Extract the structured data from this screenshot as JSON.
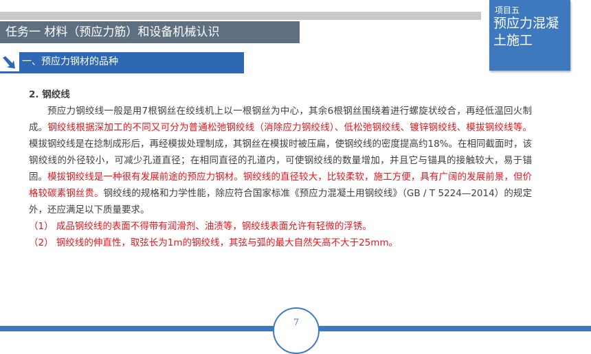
{
  "header": {
    "task_title": "任务一   材料（预应力筋）和设备机械认识",
    "project_label": "项目五",
    "project_name": "预应力混凝土施工"
  },
  "section": {
    "title": "一、预应力钢材的品种"
  },
  "content": {
    "heading": "2. 钢绞线",
    "para_segments": [
      {
        "text": "预应力钢绞线一般是用7根钢丝在绞线机上以一根钢丝为中心，其余6根钢丝围绕着进行螺旋状绞合，再经低温回火制成。",
        "red": false
      },
      {
        "text": "钢绞线根据深加工的不同又可分为普通松弛钢绞线（消除应力钢绞线）、低松弛钢绞线、镀锌钢绞线、模拔钢绞线等。",
        "red": true
      },
      {
        "text": "模拔钢绞线是在捻制成形后，再经模拔处理制成，其钢丝在模拔时被压扁，使钢绞线的密度提高约18%。在相同截面时，该钢绞线的外径较小，可减少孔道直径；在相同直径的孔道内，可使钢绞线的数量增加，并且它与锚具的接触较大，易于锚固。",
        "red": false
      },
      {
        "text": "模拔钢绞线是一种很有发展前途的预应力钢材。钢绞线的直径较大，比较柔软，施工方便，具有广阔的发展前景，但价格较碳素钢丝贵。",
        "red": true
      },
      {
        "text": "钢绞线的规格和力学性能，除应符合国家标准《预应力混凝土用钢绞线》（GB / T 5224—2014）的规定外，还应满足以下质量要求。",
        "red": false
      }
    ],
    "requirements": [
      "（1） 成品钢绞线的表面不得带有润滑剂、油渍等，钢绞线表面允许有轻微的浮锈。",
      "（2） 钢绞线的伸直性，取弦长为1m的钢绞线，其弦与弧的最大自然矢高不大于25mm。"
    ]
  },
  "footer": {
    "page_number": "7"
  },
  "colors": {
    "accent_blue": "#3e79c0",
    "title_gray": "#5f6f82",
    "highlight_red": "#e8141c"
  }
}
